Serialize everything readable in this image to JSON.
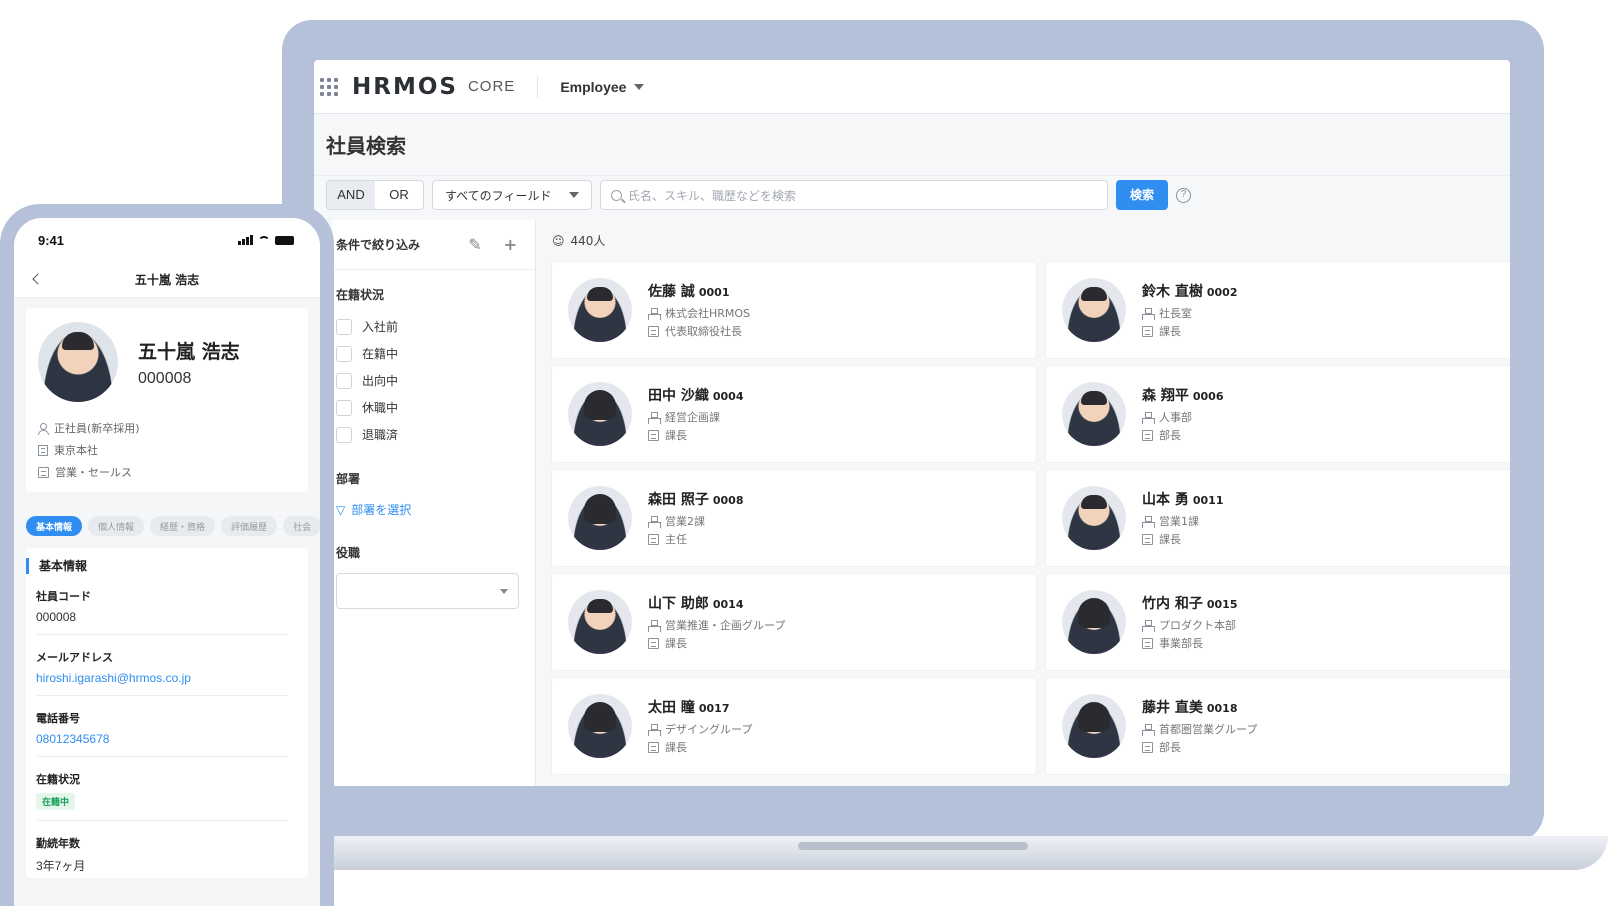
{
  "laptop": {
    "app": {
      "logo": "HRMOS",
      "logo_sub": "CORE",
      "menu": "Employee"
    },
    "page_title": "社員検索",
    "search": {
      "and_label": "AND",
      "or_label": "OR",
      "field_select": "すべてのフィールド",
      "placeholder": "氏名、スキル、職歴などを検索",
      "button": "検索",
      "help": "?"
    },
    "filter": {
      "title": "条件で絞り込み",
      "status_heading": "在籍状況",
      "statuses": [
        "入社前",
        "在籍中",
        "出向中",
        "休職中",
        "退職済"
      ],
      "dept_heading": "部署",
      "dept_link": "部署を選択",
      "role_heading": "役職"
    },
    "result_count": "440人",
    "employees": [
      {
        "name": "佐藤 誠",
        "code": "0001",
        "org": "株式会社HRMOS",
        "position": "代表取締役社長"
      },
      {
        "name": "鈴木 直樹",
        "code": "0002",
        "org": "社長室",
        "position": "課長"
      },
      {
        "name": "田中 沙織",
        "code": "0004",
        "org": "経営企画課",
        "position": "課長"
      },
      {
        "name": "森 翔平",
        "code": "0006",
        "org": "人事部",
        "position": "部長"
      },
      {
        "name": "森田 照子",
        "code": "0008",
        "org": "営業2課",
        "position": "主任"
      },
      {
        "name": "山本 勇",
        "code": "0011",
        "org": "営業1課",
        "position": "課長"
      },
      {
        "name": "山下 助郎",
        "code": "0014",
        "org": "営業推進・企画グループ",
        "position": "課長"
      },
      {
        "name": "竹内 和子",
        "code": "0015",
        "org": "プロダクト本部",
        "position": "事業部長"
      },
      {
        "name": "太田 瞳",
        "code": "0017",
        "org": "デザイングループ",
        "position": "課長"
      },
      {
        "name": "藤井 直美",
        "code": "0018",
        "org": "首都圏営業グループ",
        "position": "部長"
      }
    ]
  },
  "phone": {
    "time": "9:41",
    "nav_title": "五十嵐 浩志",
    "profile": {
      "name": "五十嵐 浩志",
      "code": "000008",
      "employment": "正社員(新卒採用)",
      "office": "東京本社",
      "department": "営業・セールス"
    },
    "tabs": [
      "基本情報",
      "個人情報",
      "経歴・資格",
      "評価履歴",
      "社会"
    ],
    "section_title": "基本情報",
    "fields": {
      "code_label": "社員コード",
      "code_value": "000008",
      "email_label": "メールアドレス",
      "email_value": "hiroshi.igarashi@hrmos.co.jp",
      "phone_label": "電話番号",
      "phone_value": "08012345678",
      "status_label": "在籍状況",
      "status_value": "在籍中",
      "tenure_label": "勤続年数",
      "tenure_value": "3年7ヶ月"
    }
  }
}
